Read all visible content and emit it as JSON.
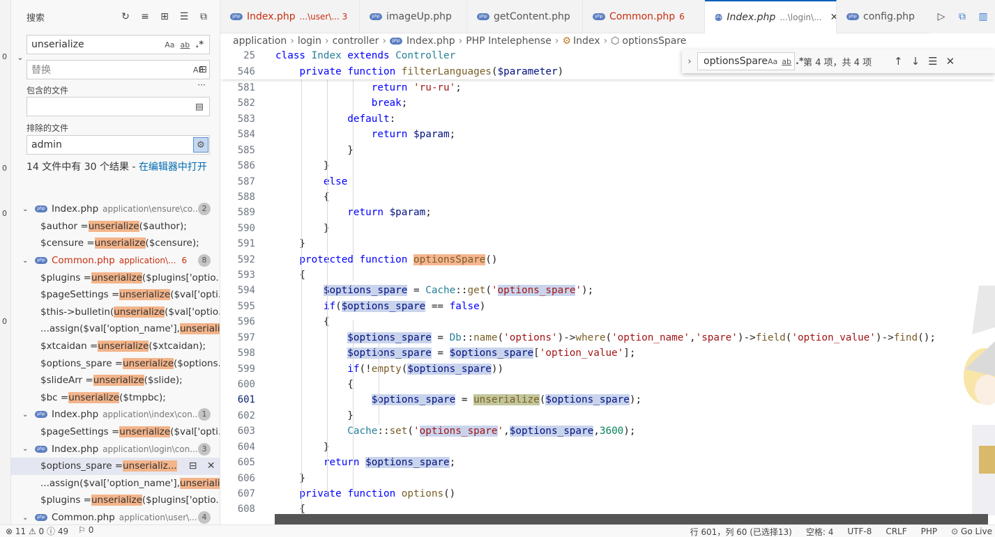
{
  "sidebar": {
    "title": "搜索",
    "search_value": "unserialize",
    "replace_placeholder": "替换",
    "include_label": "包含的文件",
    "include_value": "",
    "exclude_label": "排除的文件",
    "exclude_value": "admin",
    "result_summary": "14 文件中有 30 个结果 - ",
    "open_in_editor": "在编辑器中打开",
    "match_case": "Aa",
    "whole_word": "ab",
    "regex": ".*",
    "preserve_case": "AB",
    "more": "···",
    "tree": [
      {
        "kind": "file",
        "name": "Index.php",
        "path": "application\\ensure\\co...",
        "count": "2"
      },
      {
        "kind": "match",
        "pre": "$author = ",
        "hit": "unserialize",
        "post": "($author);"
      },
      {
        "kind": "match",
        "pre": "$censure = ",
        "hit": "unserialize",
        "post": "($censure);"
      },
      {
        "kind": "file",
        "name": "Common.php",
        "path": "application\\...",
        "errors": "6",
        "count": "8",
        "red": true
      },
      {
        "kind": "match",
        "pre": "$plugins = ",
        "hit": "unserialize",
        "post": "($plugins['optio..."
      },
      {
        "kind": "match",
        "pre": "$pageSettings = ",
        "hit": "unserialize",
        "post": "($val['opti..."
      },
      {
        "kind": "match",
        "pre": "$this->bulletin(",
        "hit": "unserialize",
        "post": "($val['optio..."
      },
      {
        "kind": "match",
        "pre": "...assign($val['option_name'], ",
        "hit": "unseriali...",
        "post": ""
      },
      {
        "kind": "match",
        "pre": "$xtcaidan = ",
        "hit": "unserialize",
        "post": "($xtcaidan);"
      },
      {
        "kind": "match",
        "pre": "$options_spare = ",
        "hit": "unserialize",
        "post": "($options..."
      },
      {
        "kind": "match",
        "pre": "$slideArr = ",
        "hit": "unserialize",
        "post": "($slide);"
      },
      {
        "kind": "match",
        "pre": "$bc = ",
        "hit": "unserialize",
        "post": "($tmpbc);"
      },
      {
        "kind": "file",
        "name": "Index.php",
        "path": "application\\index\\con...",
        "count": "1"
      },
      {
        "kind": "match",
        "pre": "$pageSettings = ",
        "hit": "unserialize",
        "post": "($val['opti..."
      },
      {
        "kind": "file",
        "name": "Index.php",
        "path": "application\\login\\con...",
        "count": "3"
      },
      {
        "kind": "match",
        "pre": "$options_spare = ",
        "hit": "unserializ...",
        "post": "",
        "selected": true
      },
      {
        "kind": "match",
        "pre": "...assign($val['option_name'], ",
        "hit": "unseriali...",
        "post": ""
      },
      {
        "kind": "match",
        "pre": "$plugins = ",
        "hit": "unserialize",
        "post": "($plugins['optio..."
      },
      {
        "kind": "file",
        "name": "Common.php",
        "path": "application\\user\\...",
        "count": "4"
      }
    ]
  },
  "tabs": [
    {
      "name": "Index.php",
      "path": "...\\user\\... 3",
      "red": true
    },
    {
      "name": "imageUp.php",
      "path": ""
    },
    {
      "name": "getContent.php",
      "path": ""
    },
    {
      "name": "Common.php",
      "path": "6",
      "red": true
    },
    {
      "name": "Index.php",
      "path": "...\\login\\...",
      "active": true
    },
    {
      "name": "config.php",
      "path": ""
    }
  ],
  "breadcrumb": [
    "application",
    "login",
    "controller",
    "Index.php",
    "PHP Intelephense",
    "Index",
    "optionsSpare"
  ],
  "find": {
    "value": "optionsSpare",
    "result": "第 4 项，共 4 项",
    "match_case": "Aa",
    "whole_word": "ab",
    "regex": ".*"
  },
  "editor": {
    "sticky": [
      {
        "n": "25",
        "html": "<span class=\"kw\">class</span> <span class=\"cl\">Index</span> <span class=\"kw\">extends</span> <span class=\"cl\">Controller</span>"
      },
      {
        "n": "546",
        "html": "    <span class=\"kw\">private</span> <span class=\"kw\">function</span> <span class=\"fn\">filterLanguages</span>(<span class=\"va\">$parameter</span>)"
      }
    ],
    "lines": [
      {
        "n": "581",
        "html": "                <span class=\"kw\">return</span> <span class=\"st\">'ru-ru'</span>;"
      },
      {
        "n": "582",
        "html": "                <span class=\"kw\">break</span>;"
      },
      {
        "n": "583",
        "html": "            <span class=\"kw\">default</span>:"
      },
      {
        "n": "584",
        "html": "                <span class=\"kw\">return</span> <span class=\"va\">$param</span>;"
      },
      {
        "n": "585",
        "html": "            }"
      },
      {
        "n": "586",
        "html": "        }"
      },
      {
        "n": "587",
        "html": "        <span class=\"kw\">else</span>"
      },
      {
        "n": "588",
        "html": "        {"
      },
      {
        "n": "589",
        "html": "            <span class=\"kw\">return</span> <span class=\"va\">$param</span>;"
      },
      {
        "n": "590",
        "html": "        }"
      },
      {
        "n": "591",
        "html": "    }"
      },
      {
        "n": "592",
        "html": "    <span class=\"kw\">protected</span> <span class=\"kw\">function</span> <span class=\"fn sh\">optionsSpare</span>()"
      },
      {
        "n": "593",
        "html": "    {"
      },
      {
        "n": "594",
        "html": "        <span class=\"va sv\">$options_spare</span> = <span class=\"cl\">Cache</span>::<span class=\"fn\">get</span>(<span class=\"st\">'<span class=\"sv\">options_spare</span>'</span>);"
      },
      {
        "n": "595",
        "html": "        <span class=\"kw\">if</span>(<span class=\"va sv\">$options_spare</span> == <span class=\"kw\">false</span>)"
      },
      {
        "n": "596",
        "html": "        {"
      },
      {
        "n": "597",
        "html": "            <span class=\"va sv\">$options_spare</span> = <span class=\"cl\">Db</span>::<span class=\"fn\">name</span>(<span class=\"st\">'options'</span>)-><span class=\"fn\">where</span>(<span class=\"st\">'option_name'</span>,<span class=\"st\">'spare'</span>)-><span class=\"fn\">field</span>(<span class=\"st\">'option_value'</span>)-><span class=\"fn\">find</span>();"
      },
      {
        "n": "598",
        "html": "            <span class=\"va sv\">$options_spare</span> = <span class=\"va sv\">$options_spare</span>[<span class=\"st\">'option_value'</span>];"
      },
      {
        "n": "599",
        "html": "            <span class=\"kw\">if</span>(!<span class=\"fn\">empty</span>(<span class=\"va sv\">$options_spare</span>))"
      },
      {
        "n": "600",
        "html": "            {"
      },
      {
        "n": "601",
        "html": "                <span class=\"va sv\">$options_spare</span> = <span class=\"fn su\">unserialize</span>(<span class=\"va sv\">$options_spare</span>);",
        "cur": true
      },
      {
        "n": "602",
        "html": "            }"
      },
      {
        "n": "603",
        "html": "            <span class=\"cl\">Cache</span>::<span class=\"fn\">set</span>(<span class=\"st\">'<span class=\"sv\">options_spare</span>'</span>,<span class=\"va sv\">$options_spare</span>,<span class=\"mt\">3600</span>);"
      },
      {
        "n": "604",
        "html": "        }"
      },
      {
        "n": "605",
        "html": "        <span class=\"kw\">return</span> <span class=\"va sv\">$options_spare</span>;"
      },
      {
        "n": "606",
        "html": "    }"
      },
      {
        "n": "607",
        "html": "    <span class=\"kw\">private</span> <span class=\"kw\">function</span> <span class=\"fn\">options</span>()"
      },
      {
        "n": "608",
        "html": "    {"
      }
    ]
  },
  "statusbar": {
    "errors": "11",
    "warnings": "0",
    "infos": "49",
    "ports": "0",
    "position": "行 601，列 60 (已选择13)",
    "spaces": "空格: 4",
    "encoding": "UTF-8",
    "eol": "CRLF",
    "language": "PHP",
    "golive": "Go Live"
  }
}
